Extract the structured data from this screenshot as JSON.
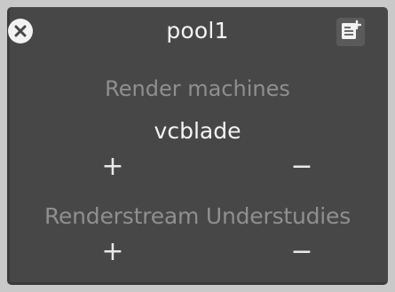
{
  "panel": {
    "title": "pool1",
    "icons": {
      "close": "close-circle-icon",
      "edit": "edit-notes-icon"
    }
  },
  "render_machines": {
    "label": "Render machines",
    "items": [
      "vcblade"
    ],
    "add_label": "+",
    "remove_label": "−"
  },
  "understudies": {
    "label": "Renderstream Understudies",
    "add_label": "+",
    "remove_label": "−"
  },
  "colors": {
    "background": "#474747",
    "text": "#f4f4f4",
    "label_muted": "#8f8f8f"
  }
}
